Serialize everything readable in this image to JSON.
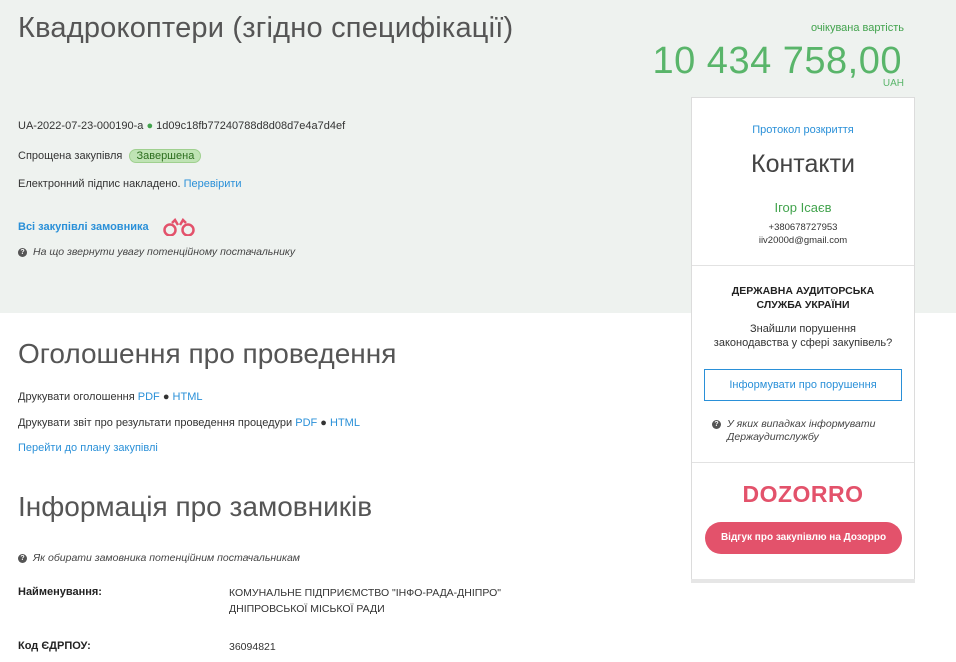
{
  "header": {
    "title": "Квадрокоптери (згідно специфікації)",
    "amount_label": "очікувана вартість",
    "amount": "10 434 758,00",
    "currency": "UAH"
  },
  "tender": {
    "id": "UA-2022-07-23-000190-a",
    "hash": "1d09c18fb77240788d8d08d7e4a7d4ef",
    "procedure_type": "Спрощена закупівля",
    "status": "Завершена",
    "signature_text": "Електронний підпис накладено.",
    "signature_link": "Перевірити",
    "all_tenders_link": "Всі закупівлі замовника",
    "hint": "На що звернути увагу потенційному постачальнику"
  },
  "announcement": {
    "heading": "Оголошення про проведення",
    "print_announcement": "Друкувати оголошення",
    "print_report": "Друкувати звіт про результати проведення процедури",
    "pdf": "PDF",
    "html": "HTML",
    "separator": "●",
    "plan_link": "Перейти до плану закупівлі"
  },
  "customers": {
    "heading": "Інформація про замовників",
    "hint": "Як обирати замовника потенційним постачальникам",
    "name_label": "Найменування:",
    "name_value": "КОМУНАЛЬНЕ ПІДПРИЄМСТВО \"ІНФО-РАДА-ДНІПРО\" ДНІПРОВСЬКОЇ МІСЬКОЇ РАДИ",
    "code_label": "Код ЄДРПОУ:",
    "code_value": "36094821"
  },
  "sidebar": {
    "protocol_link": "Протокол розкриття",
    "contacts_heading": "Контакти",
    "contact_name": "Ігор Ісаєв",
    "contact_phone": "+380678727953",
    "contact_email": "iiv2000d@gmail.com",
    "audit_title_1": "ДЕРЖАВНА АУДИТОРСЬКА",
    "audit_title_2": "СЛУЖБА УКРАЇНИ",
    "audit_text_1": "Знайшли порушення",
    "audit_text_2": "законодавства у сфері закупівель?",
    "report_button": "Інформувати про порушення",
    "audit_hint_1": "У яких випадках інформувати",
    "audit_hint_2": "Держаудитслужбу",
    "dozorro_logo": "DOZORRO",
    "dozorro_button": "Відгук про закупівлю на Дозорро"
  },
  "colors": {
    "hero_bg": "#eef2ef",
    "green": "#59b56a",
    "link": "#2a90d8",
    "red": "#e3526b"
  }
}
